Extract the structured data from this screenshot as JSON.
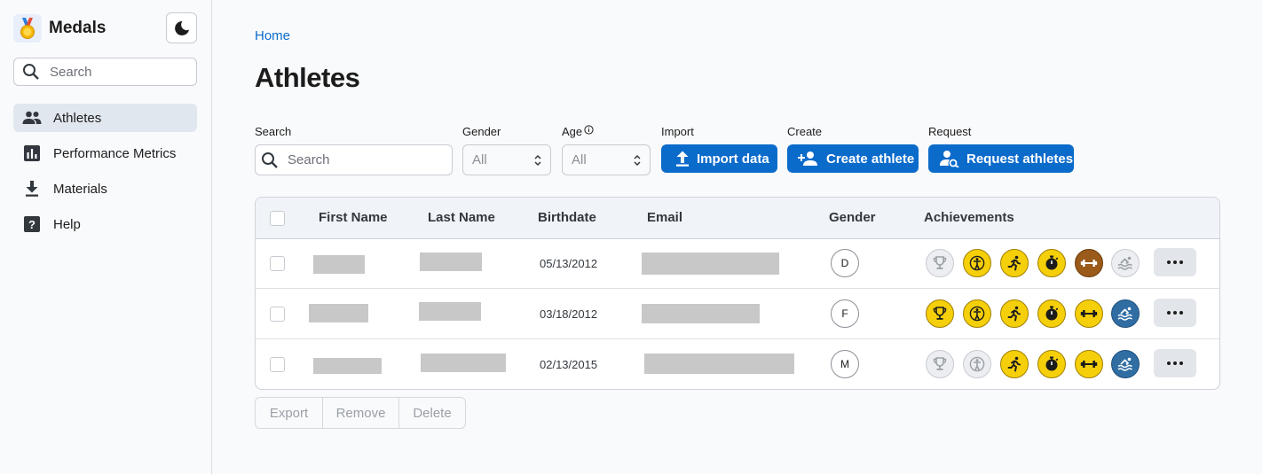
{
  "app": {
    "name": "Medals"
  },
  "sidebar": {
    "search_placeholder": "Search",
    "items": [
      {
        "label": "Athletes",
        "icon": "people-icon",
        "active": true
      },
      {
        "label": "Performance Metrics",
        "icon": "bar-chart-icon",
        "active": false
      },
      {
        "label": "Materials",
        "icon": "download-icon",
        "active": false
      },
      {
        "label": "Help",
        "icon": "help-icon",
        "active": false
      }
    ]
  },
  "breadcrumb": "Home",
  "page_title": "Athletes",
  "filters": {
    "search_label": "Search",
    "search_placeholder": "Search",
    "gender_label": "Gender",
    "gender_value": "All",
    "age_label": "Age",
    "age_value": "All"
  },
  "actions": {
    "import_label": "Import",
    "import_button": "Import data",
    "create_label": "Create",
    "create_button": "Create athlete",
    "request_label": "Request",
    "request_button": "Request athletes"
  },
  "table": {
    "headers": {
      "first_name": "First Name",
      "last_name": "Last Name",
      "birthdate": "Birthdate",
      "email": "Email",
      "gender": "Gender",
      "achievements": "Achievements"
    },
    "rows": [
      {
        "birthdate": "05/13/2012",
        "gender": "D",
        "achievements": [
          {
            "name": "trophy-icon",
            "status": "none"
          },
          {
            "name": "body-icon",
            "status": "gold"
          },
          {
            "name": "running-icon",
            "status": "gold"
          },
          {
            "name": "stopwatch-icon",
            "status": "gold"
          },
          {
            "name": "dumbbell-icon",
            "status": "bronze"
          },
          {
            "name": "swimming-icon",
            "status": "none"
          }
        ]
      },
      {
        "birthdate": "03/18/2012",
        "gender": "F",
        "achievements": [
          {
            "name": "trophy-icon",
            "status": "gold"
          },
          {
            "name": "body-icon",
            "status": "gold"
          },
          {
            "name": "running-icon",
            "status": "gold"
          },
          {
            "name": "stopwatch-icon",
            "status": "gold"
          },
          {
            "name": "dumbbell-icon",
            "status": "gold"
          },
          {
            "name": "swimming-icon",
            "status": "blue"
          }
        ]
      },
      {
        "birthdate": "02/13/2015",
        "gender": "M",
        "achievements": [
          {
            "name": "trophy-icon",
            "status": "none"
          },
          {
            "name": "body-icon",
            "status": "none"
          },
          {
            "name": "running-icon",
            "status": "gold"
          },
          {
            "name": "stopwatch-icon",
            "status": "gold"
          },
          {
            "name": "dumbbell-icon",
            "status": "gold"
          },
          {
            "name": "swimming-icon",
            "status": "blue"
          }
        ]
      }
    ]
  },
  "bulk_actions": {
    "export": "Export",
    "remove": "Remove",
    "delete": "Delete"
  },
  "colors": {
    "accent": "#0b6bcb",
    "gold": "#f5cf0a",
    "bronze": "#9a5a1a",
    "blue": "#2f6da3",
    "none": "#eceef1"
  }
}
